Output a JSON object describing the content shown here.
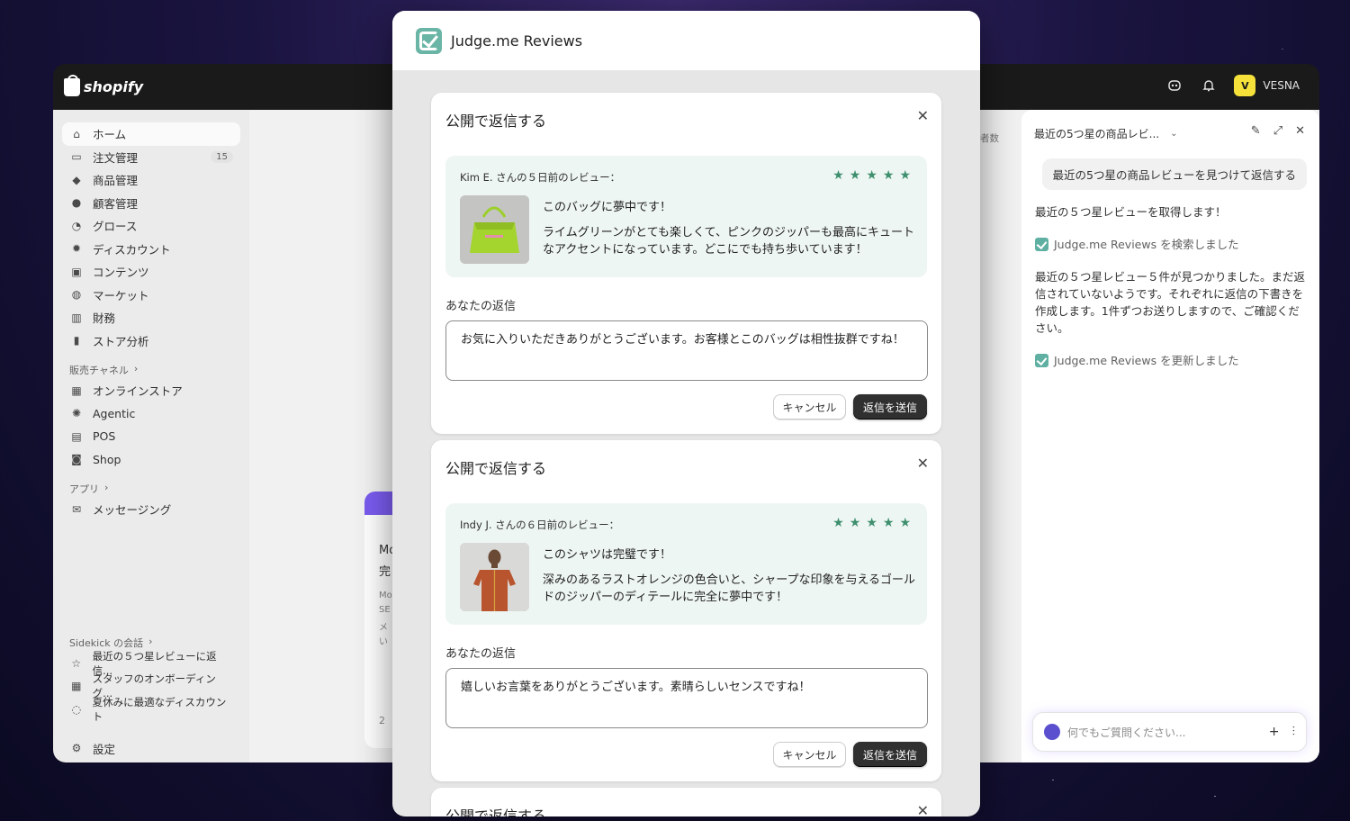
{
  "admin": {
    "brand": "shopify",
    "store_initial": "V",
    "store_name": "VESNA"
  },
  "sidebar": {
    "items": [
      {
        "label": "ホーム",
        "icon": "home-icon"
      },
      {
        "label": "注文管理",
        "icon": "inbox-icon",
        "badge": "15"
      },
      {
        "label": "商品管理",
        "icon": "tag-icon"
      },
      {
        "label": "顧客管理",
        "icon": "person-icon"
      },
      {
        "label": "グロース",
        "icon": "gauge-icon"
      },
      {
        "label": "ディスカウント",
        "icon": "discount-icon"
      },
      {
        "label": "コンテンツ",
        "icon": "image-icon"
      },
      {
        "label": "マーケット",
        "icon": "globe-icon"
      },
      {
        "label": "財務",
        "icon": "bank-icon"
      },
      {
        "label": "ストア分析",
        "icon": "chart-bar-icon"
      }
    ],
    "sales_channels_label": "販売チャネル",
    "channels": [
      {
        "label": "オンラインストア",
        "icon": "store-icon"
      },
      {
        "label": "Agentic",
        "icon": "sparkle-icon"
      },
      {
        "label": "POS",
        "icon": "pos-icon"
      },
      {
        "label": "Shop",
        "icon": "shop-icon"
      }
    ],
    "apps_label": "アプリ",
    "apps": [
      {
        "label": "メッセージング",
        "icon": "mail-icon"
      }
    ],
    "sidekick_label": "Sidekick の会話",
    "conversations": [
      {
        "label": "最近の５つ星レビューに返信...",
        "icon": "star-icon"
      },
      {
        "label": "スタッフのオンボーディング...",
        "icon": "grid-icon"
      },
      {
        "label": "夏休みに最適なディスカウント",
        "icon": "chat-icon"
      }
    ],
    "settings_label": "設定"
  },
  "background": {
    "card_lines": [
      "Mo",
      "完",
      "Mo",
      "SE",
      "メ",
      "い"
    ],
    "card_footer": "2",
    "stat_label": "者数"
  },
  "sidekick": {
    "title": "最近の5つ星の商品レビ...",
    "user_message": "最近の5つ星の商品レビューを見つけて返信する",
    "messages": [
      {
        "type": "text",
        "text": "最近の５つ星レビューを取得します！"
      },
      {
        "type": "tool",
        "text": "Judge.me Reviews を検索しました"
      },
      {
        "type": "text",
        "text": "最近の５つ星レビュー５件が見つかりました。まだ返信されていないようです。それぞれに返信の下書きを作成します。1件ずつお送りしますので、ご確認ください。"
      },
      {
        "type": "tool",
        "text": "Judge.me Reviews を更新しました"
      }
    ],
    "input_placeholder": "何でもご質問ください..."
  },
  "modal": {
    "title": "Judge.me Reviews",
    "cards": [
      {
        "title": "公開で返信する",
        "meta": "Kim E. さんの５日前のレビュー：",
        "rating": 5,
        "review_title": "このバッグに夢中です！",
        "review_text": "ライムグリーンがとても楽しくて、ピンクのジッパーも最高にキュートなアクセントになっています。どこにでも持ち歩いています！",
        "reply_label": "あなたの返信",
        "reply_value": "お気に入りいただきありがとうございます。お客様とこのバッグは相性抜群ですね！",
        "cancel_label": "キャンセル",
        "send_label": "返信を送信",
        "product_image": "lime-green-bag"
      },
      {
        "title": "公開で返信する",
        "meta": "Indy J. さんの６日前のレビュー：",
        "rating": 5,
        "review_title": "このシャツは完璧です！",
        "review_text": "深みのあるラストオレンジの色合いと、シャープな印象を与えるゴールドのジッパーのディテールに完全に夢中です！",
        "reply_label": "あなたの返信",
        "reply_value": "嬉しいお言葉をありがとうございます。素晴らしいセンスですね！",
        "cancel_label": "キャンセル",
        "send_label": "返信を送信",
        "product_image": "orange-shirt-model"
      },
      {
        "title": "公開で返信する"
      }
    ]
  },
  "colors": {
    "accent_green": "#3e8f6e",
    "judgeme_teal": "#6ab5a6",
    "review_bg": "#eef6f3",
    "primary_button": "#303030"
  }
}
